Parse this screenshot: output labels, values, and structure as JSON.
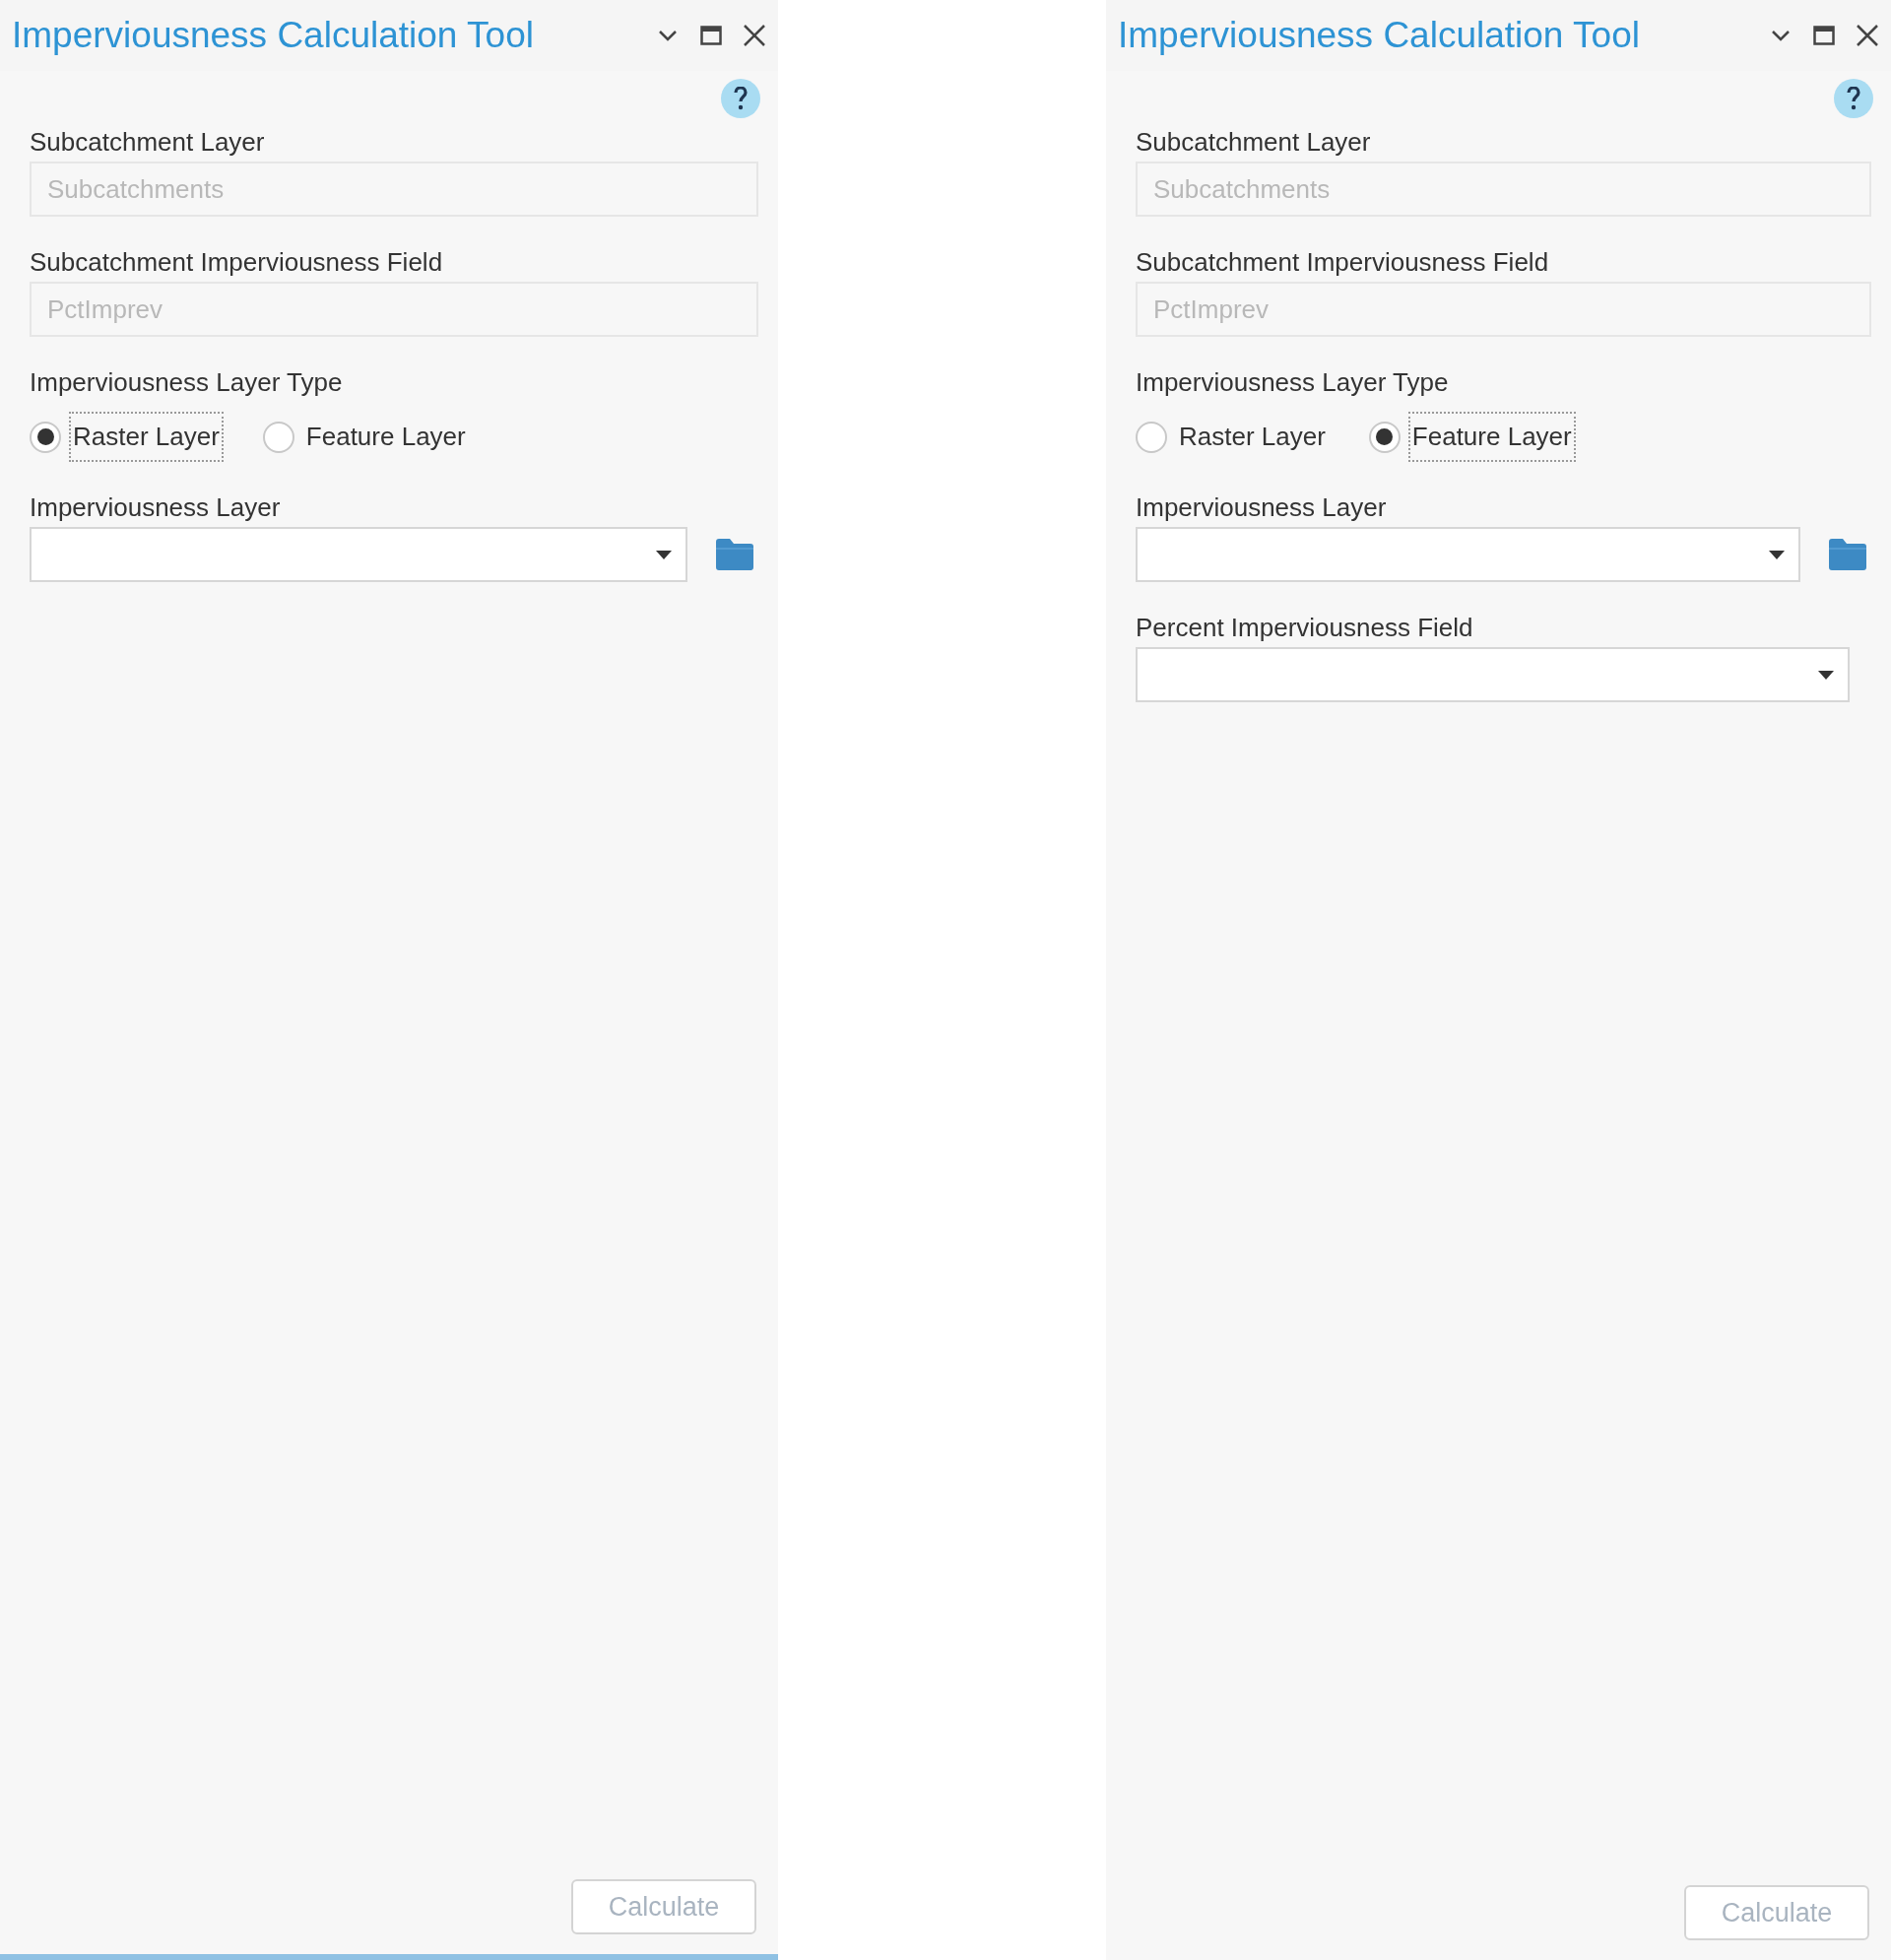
{
  "panels": [
    {
      "title": "Imperviousness Calculation Tool",
      "active": true,
      "fields": [
        {
          "kind": "text",
          "label": "Subcatchment Layer",
          "value": "Subcatchments",
          "disabled": true
        },
        {
          "kind": "text",
          "label": "Subcatchment Imperviousness Field",
          "value": "PctImprev",
          "disabled": true
        },
        {
          "kind": "radio",
          "label": "Imperviousness Layer Type",
          "options": [
            {
              "label": "Raster Layer",
              "selected": true
            },
            {
              "label": "Feature Layer",
              "selected": false
            }
          ]
        },
        {
          "kind": "dropdown",
          "label": "Imperviousness Layer",
          "browse": true
        }
      ],
      "button": {
        "label": "Calculate",
        "disabled": true
      }
    },
    {
      "title": "Imperviousness Calculation Tool",
      "active": false,
      "fields": [
        {
          "kind": "text",
          "label": "Subcatchment Layer",
          "value": "Subcatchments",
          "disabled": true
        },
        {
          "kind": "text",
          "label": "Subcatchment Imperviousness Field",
          "value": "PctImprev",
          "disabled": true
        },
        {
          "kind": "radio",
          "label": "Imperviousness Layer Type",
          "options": [
            {
              "label": "Raster Layer",
              "selected": false
            },
            {
              "label": "Feature Layer",
              "selected": true
            }
          ]
        },
        {
          "kind": "dropdown",
          "label": "Imperviousness Layer",
          "browse": true
        },
        {
          "kind": "dropdown",
          "label": "Percent Imperviousness Field",
          "browse": false
        }
      ],
      "button": {
        "label": "Calculate",
        "disabled": true
      }
    }
  ]
}
